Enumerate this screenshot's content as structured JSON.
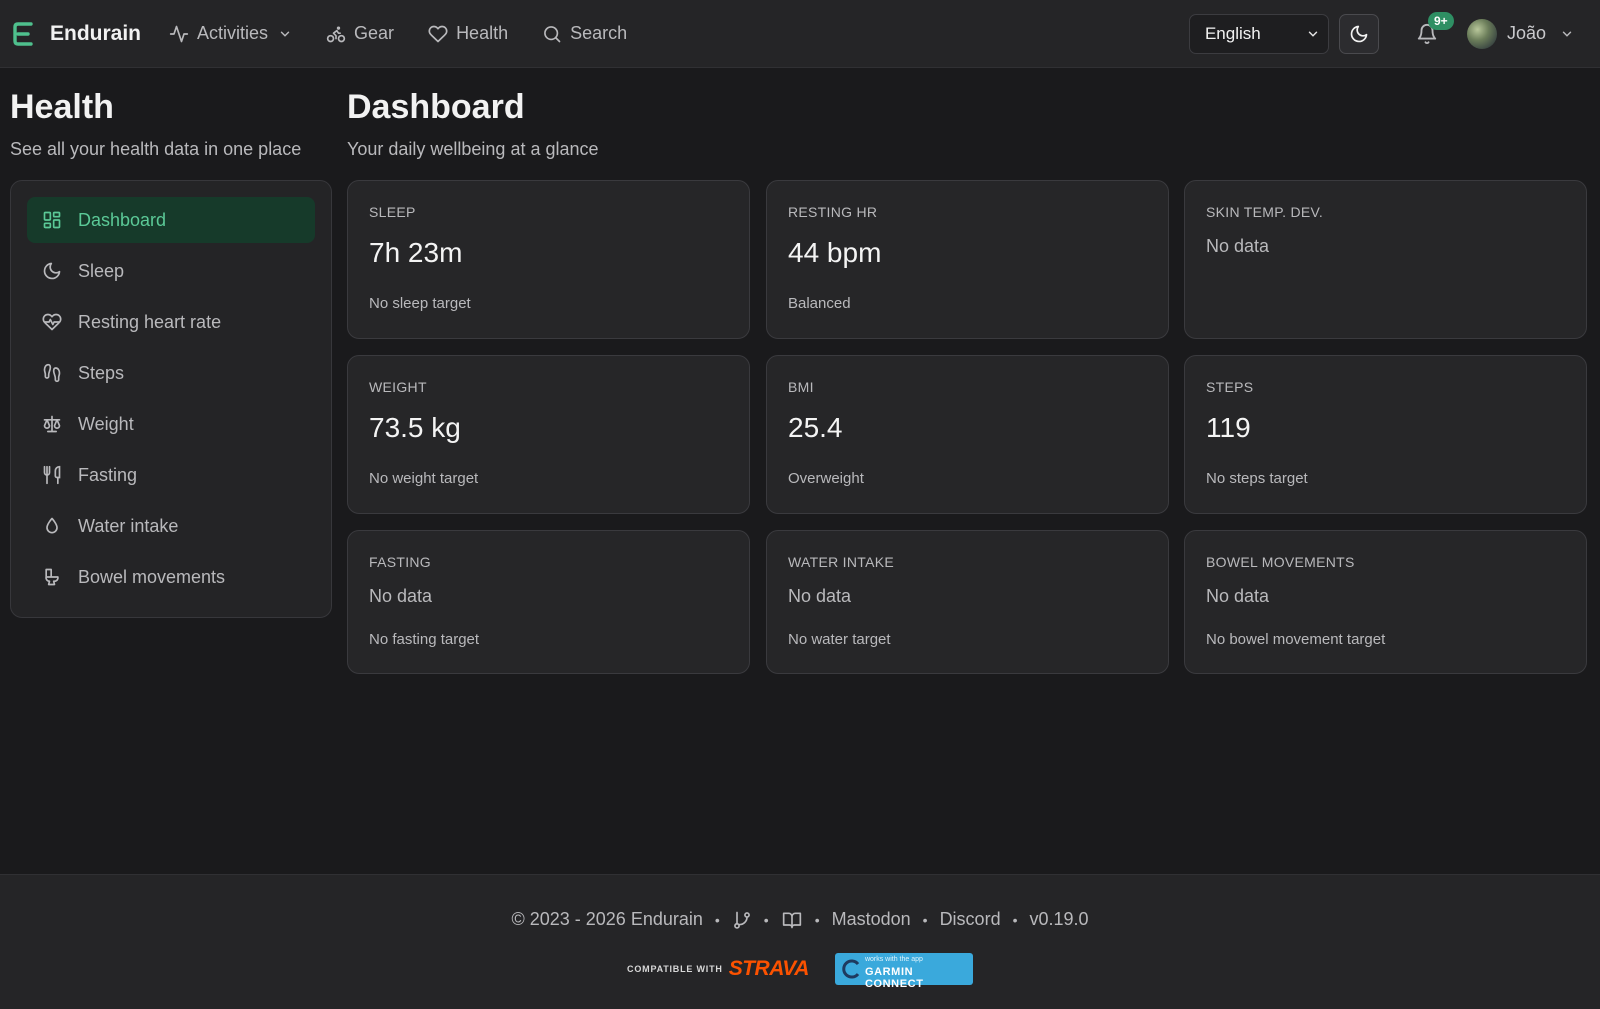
{
  "navbar": {
    "brand": "Endurain",
    "links": [
      {
        "label": "Activities",
        "icon": "activity-icon",
        "has_dropdown": true
      },
      {
        "label": "Gear",
        "icon": "bike-icon"
      },
      {
        "label": "Health",
        "icon": "heart-icon"
      },
      {
        "label": "Search",
        "icon": "search-icon"
      }
    ],
    "language": "English",
    "notifications_badge": "9+",
    "user_name": "João"
  },
  "left": {
    "title": "Health",
    "subtitle": "See all your health data in one place"
  },
  "sidebar": {
    "items": [
      {
        "label": "Dashboard",
        "icon": "dashboard-icon",
        "active": true
      },
      {
        "label": "Sleep",
        "icon": "moon-icon"
      },
      {
        "label": "Resting heart rate",
        "icon": "heart-pulse-icon"
      },
      {
        "label": "Steps",
        "icon": "footprints-icon"
      },
      {
        "label": "Weight",
        "icon": "scale-icon"
      },
      {
        "label": "Fasting",
        "icon": "utensils-icon"
      },
      {
        "label": "Water intake",
        "icon": "droplet-icon"
      },
      {
        "label": "Bowel movements",
        "icon": "toilet-icon"
      }
    ]
  },
  "main": {
    "title": "Dashboard",
    "subtitle": "Your daily wellbeing at a glance"
  },
  "cards": [
    {
      "label": "SLEEP",
      "value": "7h 23m",
      "note": "No sleep target"
    },
    {
      "label": "RESTING HR",
      "value": "44 bpm",
      "note": "Balanced"
    },
    {
      "label": "SKIN TEMP. DEV.",
      "nodata": "No data"
    },
    {
      "label": "WEIGHT",
      "value": "73.5 kg",
      "note": "No weight target"
    },
    {
      "label": "BMI",
      "value": "25.4",
      "note": "Overweight"
    },
    {
      "label": "STEPS",
      "value": "119",
      "note": "No steps target"
    },
    {
      "label": "FASTING",
      "nodata": "No data",
      "note": "No fasting target"
    },
    {
      "label": "WATER INTAKE",
      "nodata": "No data",
      "note": "No water target"
    },
    {
      "label": "BOWEL MOVEMENTS",
      "nodata": "No data",
      "note": "No bowel movement target"
    }
  ],
  "footer": {
    "copyright": "© 2023 - 2026 Endurain",
    "mastodon": "Mastodon",
    "discord": "Discord",
    "version": "v0.19.0",
    "strava_compat": "COMPATIBLE WITH",
    "strava_logo": "STRAVA",
    "garmin_small": "works with the app",
    "garmin_main": "GARMIN CONNECT"
  },
  "colors": {
    "accent": "#4fc08d",
    "active_bg": "#163a2a",
    "badge": "#2e8f63",
    "strava": "#fc5200",
    "garmin": "#3aa9dc"
  }
}
